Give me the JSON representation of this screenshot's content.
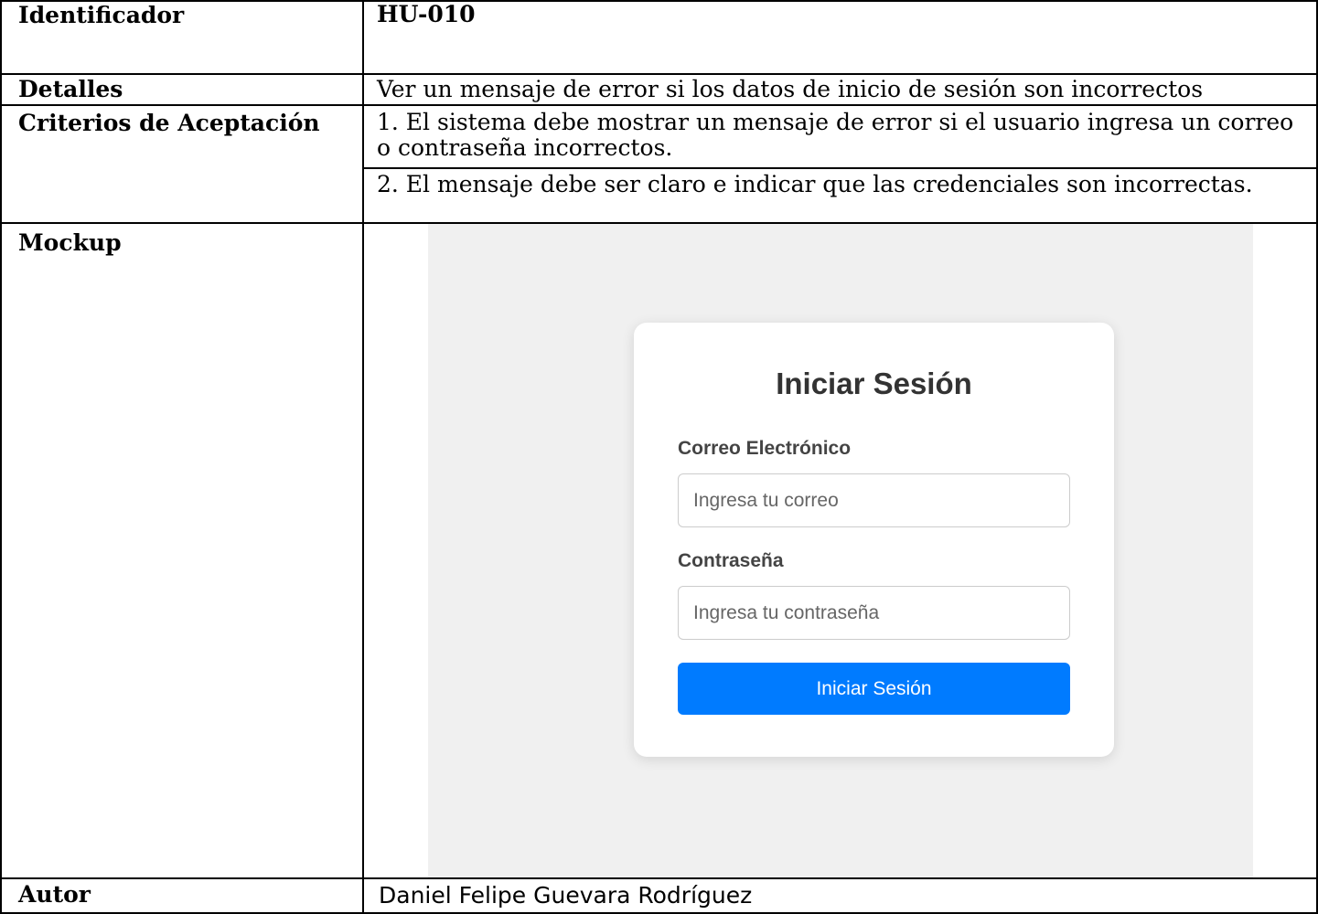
{
  "table": {
    "identifier": {
      "label": "Identificador",
      "value": "HU-010"
    },
    "details": {
      "label": "Detalles",
      "value": "Ver un mensaje de error si los datos de inicio de sesión son incorrectos"
    },
    "criteria": {
      "label": "Criterios de Aceptación",
      "items": [
        {
          "line1": "1. El sistema debe mostrar un mensaje de error si el usuario ingresa un correo",
          "line2": "o contraseña incorrectos."
        },
        {
          "line1": "2. El mensaje debe ser claro e indicar que las credenciales son incorrectas."
        }
      ]
    },
    "mockup": {
      "label": "Mockup"
    },
    "author": {
      "label": "Autor",
      "value": "Daniel Felipe Guevara Rodríguez"
    }
  },
  "login_mockup": {
    "title": "Iniciar Sesión",
    "email_label": "Correo Electrónico",
    "email_placeholder": "Ingresa tu correo",
    "password_label": "Contraseña",
    "password_placeholder": "Ingresa tu contraseña",
    "submit_label": "Iniciar Sesión",
    "colors": {
      "button": "#007bff",
      "background": "#f0f0f0",
      "card": "#ffffff"
    }
  }
}
